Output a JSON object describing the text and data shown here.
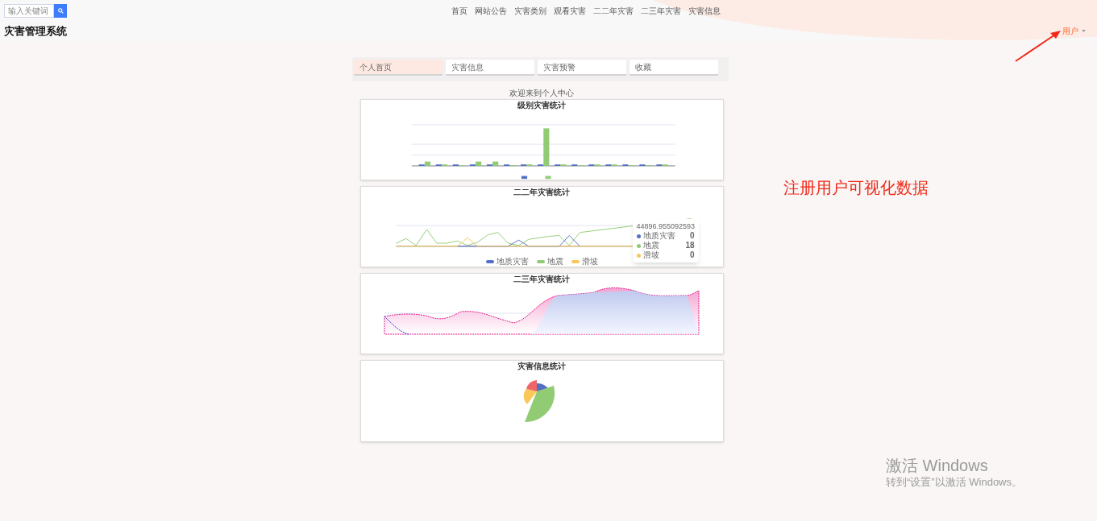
{
  "header": {
    "search": {
      "placeholder": "输入关键词"
    },
    "title": "灾害管理系统",
    "nav": [
      "首页",
      "网站公告",
      "灾害类别",
      "观看灾害",
      "二二年灾害",
      "二三年灾害",
      "灾害信息"
    ],
    "user_menu": "用户"
  },
  "tabs": [
    {
      "label": "个人首页",
      "selected": true
    },
    {
      "label": "灾害信息",
      "selected": false
    },
    {
      "label": "灾害预警",
      "selected": false
    },
    {
      "label": "收藏",
      "selected": false
    }
  ],
  "welcome": "欢迎来到个人中心",
  "charts": [
    {
      "kind": "bar",
      "title": "级别灾害统计"
    },
    {
      "kind": "line",
      "title": "二二年灾害统计",
      "legend": [
        {
          "label": "地质灾害",
          "color": "#5470c6"
        },
        {
          "label": "地震",
          "color": "#91cc75"
        },
        {
          "label": "滑坡",
          "color": "#fac858"
        }
      ],
      "tooltip": {
        "header": "44896.955092593",
        "rows": [
          {
            "label": "地质灾害",
            "value": "0",
            "color": "#5470c6"
          },
          {
            "label": "地震",
            "value": "18",
            "color": "#91cc75"
          },
          {
            "label": "滑坡",
            "value": "0",
            "color": "#fac858"
          }
        ]
      }
    },
    {
      "kind": "area",
      "title": "二三年灾害统计"
    },
    {
      "kind": "pie",
      "title": "灾害信息统计"
    }
  ],
  "annotation": "注册用户可视化数据",
  "activation_notice": {
    "title": "激活 Windows",
    "subtitle": "转到“设置”以激活 Windows。"
  }
}
